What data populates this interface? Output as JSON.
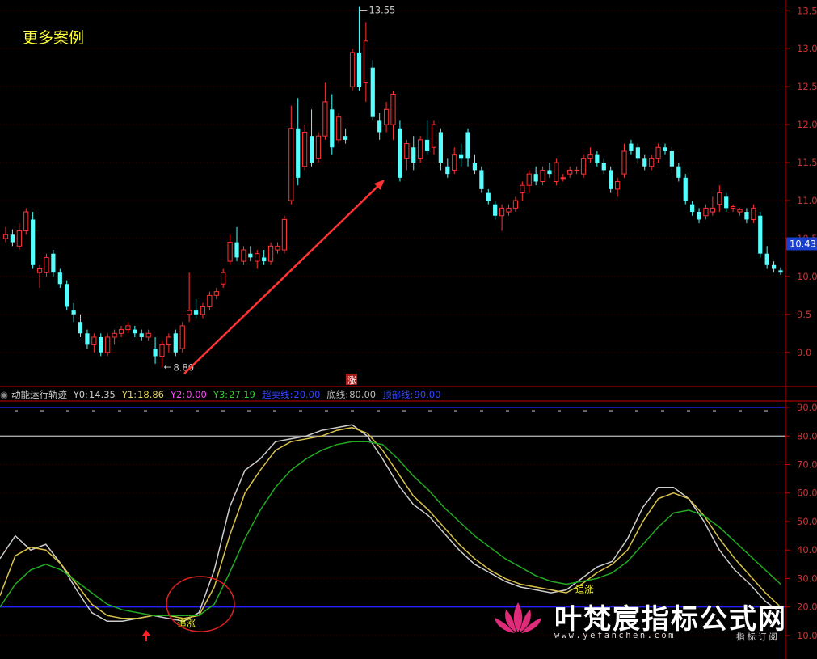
{
  "overlay": {
    "more_cases": "更多案例",
    "high_label": "13.55",
    "low_label": "8.80",
    "rise_tag": "涨",
    "current_price": "10.43",
    "signal_label": "追涨"
  },
  "indicator": {
    "name": "动能运行轨迹",
    "values": [
      {
        "label": "Y0:",
        "value": "14.35",
        "color": "#cccccc"
      },
      {
        "label": "Y1:",
        "value": "18.86",
        "color": "#e6d25a"
      },
      {
        "label": "Y2:",
        "value": "0.00",
        "color": "#ff44ff"
      },
      {
        "label": "Y3:",
        "value": "27.19",
        "color": "#33cc33"
      },
      {
        "label": "超卖线:",
        "value": "20.00",
        "color": "#3344ff"
      },
      {
        "label": "底线:",
        "value": "80.00",
        "color": "#bbbbbb"
      },
      {
        "label": "顶部线:",
        "value": "90.00",
        "color": "#3344ff"
      }
    ]
  },
  "watermark": {
    "main": "叶梵宸指标公式网",
    "url": "www.yefanchen.com",
    "sub": "指标订阅"
  },
  "colors": {
    "up": "#ff3333",
    "down": "#55ffff",
    "axis": "#cc0000",
    "y0": "#cccccc",
    "y1": "#d9c24a",
    "y3": "#22aa22",
    "oversold": "#2222ff",
    "top": "#2222ff",
    "bottom_line": "#bbbbbb",
    "arrow": "#ff3333"
  },
  "chart_data": [
    {
      "type": "candlestick",
      "title": "",
      "y_ticks": [
        "9.0",
        "9.5",
        "10.0",
        "10.5",
        "11.0",
        "11.5",
        "12.0",
        "12.5",
        "13.0",
        "13.5"
      ],
      "ylim": [
        8.55,
        13.62
      ],
      "high_annotation": 13.55,
      "low_annotation": 8.8,
      "last_price": 10.43,
      "ohlc": [
        [
          10.5,
          10.65,
          10.45,
          10.55
        ],
        [
          10.55,
          10.62,
          10.4,
          10.45
        ],
        [
          10.4,
          10.7,
          10.35,
          10.6
        ],
        [
          10.6,
          10.9,
          10.55,
          10.85
        ],
        [
          10.75,
          10.85,
          10.1,
          10.15
        ],
        [
          10.05,
          10.15,
          9.85,
          10.1
        ],
        [
          10.05,
          10.3,
          10.0,
          10.25
        ],
        [
          10.3,
          10.35,
          10.0,
          10.05
        ],
        [
          10.05,
          10.1,
          9.85,
          9.9
        ],
        [
          9.9,
          9.95,
          9.55,
          9.6
        ],
        [
          9.55,
          9.65,
          9.4,
          9.5
        ],
        [
          9.4,
          9.5,
          9.2,
          9.25
        ],
        [
          9.25,
          9.3,
          9.05,
          9.1
        ],
        [
          9.1,
          9.25,
          9.0,
          9.2
        ],
        [
          9.2,
          9.25,
          8.95,
          9.0
        ],
        [
          9.0,
          9.25,
          8.95,
          9.2
        ],
        [
          9.2,
          9.3,
          9.1,
          9.25
        ],
        [
          9.25,
          9.35,
          9.2,
          9.3
        ],
        [
          9.3,
          9.4,
          9.25,
          9.35
        ],
        [
          9.3,
          9.35,
          9.2,
          9.25
        ],
        [
          9.25,
          9.3,
          9.15,
          9.2
        ],
        [
          9.2,
          9.3,
          9.15,
          9.25
        ],
        [
          9.05,
          9.2,
          8.85,
          8.95
        ],
        [
          8.95,
          9.15,
          8.8,
          9.1
        ],
        [
          9.1,
          9.25,
          9.0,
          9.2
        ],
        [
          9.25,
          9.3,
          8.95,
          9.0
        ],
        [
          9.05,
          9.4,
          9.0,
          9.35
        ],
        [
          9.5,
          10.05,
          9.4,
          9.55
        ],
        [
          9.55,
          9.7,
          9.45,
          9.5
        ],
        [
          9.5,
          9.65,
          9.45,
          9.6
        ],
        [
          9.6,
          9.8,
          9.55,
          9.75
        ],
        [
          9.75,
          9.85,
          9.7,
          9.8
        ],
        [
          9.9,
          10.1,
          9.85,
          10.05
        ],
        [
          10.2,
          10.55,
          10.15,
          10.45
        ],
        [
          10.45,
          10.65,
          10.2,
          10.25
        ],
        [
          10.2,
          10.4,
          10.15,
          10.35
        ],
        [
          10.3,
          10.4,
          10.2,
          10.25
        ],
        [
          10.2,
          10.35,
          10.1,
          10.3
        ],
        [
          10.25,
          10.35,
          10.15,
          10.2
        ],
        [
          10.2,
          10.45,
          10.15,
          10.4
        ],
        [
          10.35,
          10.45,
          10.3,
          10.4
        ],
        [
          10.35,
          10.8,
          10.3,
          10.75
        ],
        [
          11.0,
          12.25,
          10.95,
          11.95
        ],
        [
          11.95,
          12.35,
          11.2,
          11.3
        ],
        [
          11.45,
          12.0,
          11.4,
          11.9
        ],
        [
          11.85,
          12.2,
          11.45,
          11.5
        ],
        [
          11.55,
          11.9,
          11.5,
          11.85
        ],
        [
          11.85,
          12.55,
          11.8,
          12.3
        ],
        [
          12.2,
          12.4,
          11.6,
          11.7
        ],
        [
          11.8,
          12.15,
          11.75,
          12.1
        ],
        [
          11.85,
          11.95,
          11.75,
          11.8
        ],
        [
          12.5,
          13.0,
          12.45,
          12.95
        ],
        [
          12.95,
          13.55,
          12.45,
          12.5
        ],
        [
          12.55,
          13.35,
          12.3,
          13.1
        ],
        [
          12.75,
          12.85,
          12.05,
          12.1
        ],
        [
          12.05,
          12.15,
          11.8,
          11.9
        ],
        [
          12.0,
          12.3,
          11.9,
          12.2
        ],
        [
          12.0,
          12.45,
          11.8,
          12.4
        ],
        [
          11.95,
          12.05,
          11.25,
          11.3
        ],
        [
          11.55,
          11.8,
          11.4,
          11.75
        ],
        [
          11.7,
          11.85,
          11.4,
          11.5
        ],
        [
          11.55,
          11.85,
          11.5,
          11.8
        ],
        [
          11.8,
          12.05,
          11.6,
          11.65
        ],
        [
          11.7,
          12.05,
          11.6,
          12.0
        ],
        [
          11.9,
          11.95,
          11.4,
          11.5
        ],
        [
          11.45,
          11.55,
          11.3,
          11.35
        ],
        [
          11.4,
          11.7,
          11.35,
          11.6
        ],
        [
          11.6,
          11.75,
          11.45,
          11.55
        ],
        [
          11.9,
          11.95,
          11.45,
          11.55
        ],
        [
          11.5,
          11.6,
          11.35,
          11.4
        ],
        [
          11.4,
          11.45,
          11.1,
          11.15
        ],
        [
          11.1,
          11.15,
          10.95,
          11.0
        ],
        [
          10.95,
          11.0,
          10.75,
          10.8
        ],
        [
          10.8,
          10.95,
          10.6,
          10.9
        ],
        [
          10.85,
          10.95,
          10.8,
          10.9
        ],
        [
          10.9,
          11.05,
          10.85,
          11.0
        ],
        [
          11.1,
          11.25,
          11.0,
          11.2
        ],
        [
          11.2,
          11.4,
          11.1,
          11.35
        ],
        [
          11.35,
          11.45,
          11.2,
          11.25
        ],
        [
          11.25,
          11.45,
          11.2,
          11.4
        ],
        [
          11.4,
          11.5,
          11.3,
          11.35
        ],
        [
          11.25,
          11.55,
          11.2,
          11.5
        ],
        [
          11.3,
          11.35,
          11.25,
          11.3
        ],
        [
          11.35,
          11.45,
          11.3,
          11.4
        ],
        [
          11.4,
          11.45,
          11.35,
          11.4
        ],
        [
          11.35,
          11.6,
          11.3,
          11.55
        ],
        [
          11.55,
          11.7,
          11.5,
          11.6
        ],
        [
          11.6,
          11.65,
          11.45,
          11.5
        ],
        [
          11.5,
          11.55,
          11.35,
          11.4
        ],
        [
          11.4,
          11.45,
          11.1,
          11.15
        ],
        [
          11.15,
          11.3,
          11.05,
          11.25
        ],
        [
          11.35,
          11.75,
          11.3,
          11.65
        ],
        [
          11.75,
          11.8,
          11.6,
          11.65
        ],
        [
          11.7,
          11.75,
          11.5,
          11.55
        ],
        [
          11.55,
          11.6,
          11.4,
          11.45
        ],
        [
          11.45,
          11.6,
          11.4,
          11.55
        ],
        [
          11.55,
          11.75,
          11.5,
          11.7
        ],
        [
          11.7,
          11.75,
          11.6,
          11.65
        ],
        [
          11.65,
          11.7,
          11.4,
          11.45
        ],
        [
          11.45,
          11.5,
          11.25,
          11.3
        ],
        [
          11.3,
          11.35,
          10.95,
          11.0
        ],
        [
          10.95,
          11.0,
          10.8,
          10.85
        ],
        [
          10.85,
          10.9,
          10.7,
          10.75
        ],
        [
          10.8,
          10.95,
          10.75,
          10.9
        ],
        [
          10.85,
          11.05,
          10.8,
          10.9
        ],
        [
          10.95,
          11.2,
          10.85,
          11.1
        ],
        [
          11.05,
          11.1,
          10.85,
          10.9
        ],
        [
          10.9,
          10.95,
          10.85,
          10.92
        ],
        [
          10.85,
          10.9,
          10.8,
          10.88
        ],
        [
          10.85,
          10.9,
          10.7,
          10.75
        ],
        [
          10.75,
          10.95,
          10.7,
          10.9
        ],
        [
          10.8,
          10.85,
          10.25,
          10.3
        ],
        [
          10.3,
          10.4,
          10.1,
          10.15
        ],
        [
          10.15,
          10.2,
          10.05,
          10.1
        ],
        [
          10.08,
          10.12,
          10.02,
          10.05
        ]
      ]
    },
    {
      "type": "line",
      "title": "动能运行轨迹",
      "y_ticks": [
        "10.0",
        "20.0",
        "30.0",
        "40.0",
        "50.0",
        "60.0",
        "70.0",
        "80.0",
        "90.0"
      ],
      "ylim": [
        6.0,
        92.0
      ],
      "reference_lines": [
        {
          "name": "超卖线",
          "value": 20.0
        },
        {
          "name": "底线",
          "value": 80.0
        },
        {
          "name": "顶部线",
          "value": 90.0
        }
      ],
      "series": [
        {
          "name": "Y0",
          "values": [
            37,
            45,
            40,
            42,
            35,
            26,
            18,
            15,
            15,
            16,
            17,
            16,
            15,
            18,
            33,
            55,
            68,
            72,
            78,
            79,
            80,
            82,
            83,
            84,
            80,
            72,
            63,
            56,
            52,
            46,
            40,
            35,
            32,
            29,
            27,
            26,
            25,
            26,
            30,
            34,
            36,
            44,
            55,
            62,
            62,
            58,
            50,
            40,
            33,
            28,
            22,
            18
          ]
        },
        {
          "name": "Y1",
          "values": [
            24,
            38,
            41,
            40,
            35,
            28,
            21,
            17,
            16,
            16,
            17,
            17,
            16,
            17,
            27,
            45,
            60,
            68,
            75,
            78,
            79,
            80,
            82,
            83,
            81,
            75,
            67,
            59,
            54,
            48,
            42,
            37,
            33,
            30,
            28,
            27,
            26,
            25,
            28,
            32,
            35,
            40,
            50,
            58,
            60,
            58,
            52,
            44,
            37,
            31,
            25,
            20
          ]
        },
        {
          "name": "Y3",
          "values": [
            20,
            28,
            33,
            35,
            33,
            29,
            25,
            21,
            19,
            18,
            17,
            17,
            17,
            17,
            21,
            32,
            44,
            54,
            62,
            68,
            72,
            75,
            77,
            78,
            78,
            77,
            72,
            66,
            61,
            55,
            50,
            45,
            41,
            37,
            34,
            31,
            29,
            28,
            29,
            30,
            32,
            36,
            42,
            48,
            53,
            54,
            52,
            48,
            43,
            38,
            33,
            28
          ]
        }
      ],
      "signals": [
        "追涨",
        "追涨"
      ],
      "signal_positions": [
        12,
        38
      ]
    }
  ]
}
